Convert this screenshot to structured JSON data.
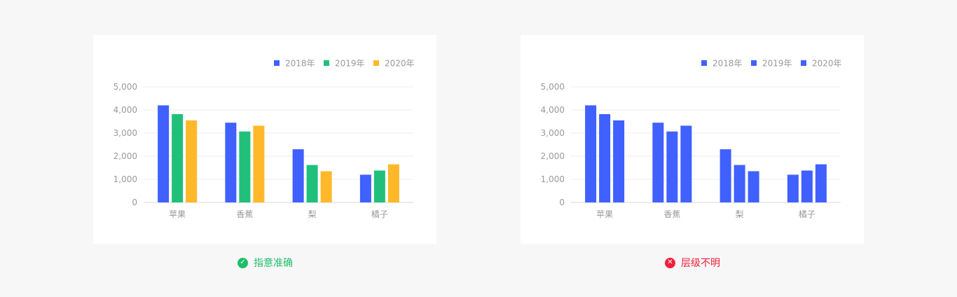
{
  "chart_data": [
    {
      "type": "bar",
      "categories": [
        "苹果",
        "香蕉",
        "梨",
        "橘子"
      ],
      "series": [
        {
          "name": "2018年",
          "values": [
            4200,
            3450,
            2300,
            1200
          ]
        },
        {
          "name": "2019年",
          "values": [
            3820,
            3070,
            1620,
            1380
          ]
        },
        {
          "name": "2020年",
          "values": [
            3550,
            3320,
            1350,
            1650
          ]
        }
      ],
      "colors": [
        "#4060ff",
        "#20c07a",
        "#ffb829"
      ],
      "ylim": [
        0,
        5000
      ],
      "yticks": [
        "0",
        "1,000",
        "2,000",
        "3,000",
        "4,000",
        "5,000"
      ],
      "grid": true,
      "legend": "top-right"
    },
    {
      "type": "bar",
      "categories": [
        "苹果",
        "香蕉",
        "梨",
        "橘子"
      ],
      "series": [
        {
          "name": "2018年",
          "values": [
            4200,
            3450,
            2300,
            1200
          ]
        },
        {
          "name": "2019年",
          "values": [
            3820,
            3070,
            1620,
            1380
          ]
        },
        {
          "name": "2020年",
          "values": [
            3550,
            3320,
            1350,
            1650
          ]
        }
      ],
      "colors": [
        "#4060ff",
        "#4060ff",
        "#4060ff"
      ],
      "ylim": [
        0,
        5000
      ],
      "yticks": [
        "0",
        "1,000",
        "2,000",
        "3,000",
        "4,000",
        "5,000"
      ],
      "grid": true,
      "legend": "top-right"
    }
  ],
  "captions": {
    "good": {
      "text": "指意准确",
      "icon": "check-circle-icon",
      "glyph": "✓",
      "color": "#1fbf6a"
    },
    "bad": {
      "text": "层级不明",
      "icon": "close-circle-icon",
      "glyph": "✕",
      "color": "#f0203a"
    }
  }
}
